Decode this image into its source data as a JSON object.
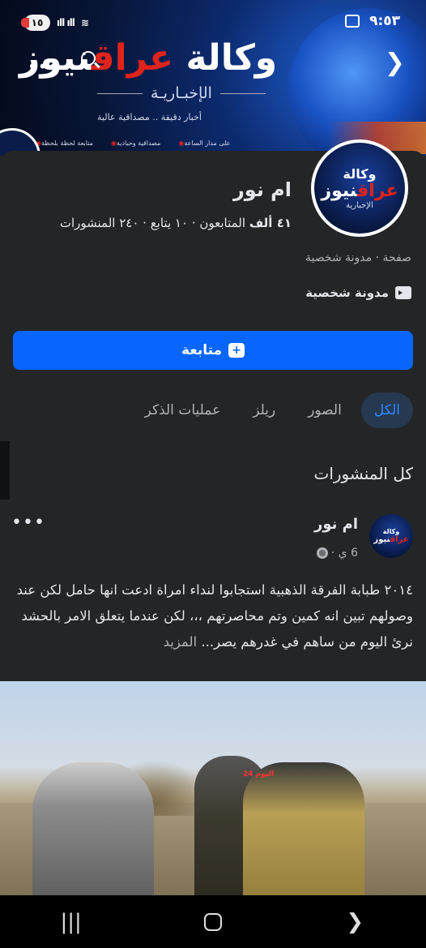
{
  "status_bar": {
    "battery": "١٥",
    "signal": "ıll ıll",
    "time": "٩:٥٣"
  },
  "cover": {
    "title_part1": "وكالة ",
    "title_part2": "عراق",
    "title_part3": "نيوز",
    "subtitle": "الإخبـاريـة",
    "tagline": "أخبار دقيقة .. مصداقية عالية",
    "strip": [
      "متابعة لحظة بلحظة",
      "مصداقية وحيادية",
      "على مدار الساعة"
    ]
  },
  "avatar": {
    "line1": "وكالة",
    "line2_red": "عراق",
    "line2_white": "نيوز",
    "line3": "الإخبارية"
  },
  "page": {
    "name": "ام نور",
    "stats_followers": "٤١ ألف",
    "stats_text": " المتابعون · ١٠ يتابع · ٢٤٠ المنشورات",
    "category": "صفحة · مدونة شخصية",
    "intro": "مدونة شخصية",
    "follow_label": "متابعة"
  },
  "tabs": [
    {
      "label": "الكل",
      "active": true
    },
    {
      "label": "الصور",
      "active": false
    },
    {
      "label": "ريلز",
      "active": false
    },
    {
      "label": "عمليات الذكر",
      "active": false
    }
  ],
  "section_title": "كل المنشورات",
  "post": {
    "author": "ام نور",
    "time": "6 ي ·",
    "text": "٢٠١٤ طبابة الفرقة الذهبية استجابوا لنداء امراة ادعت انها حامل لكن عند وصولهم تبين انه كمين وتم محاصرتهم ،،، لكن عندما يتعلق الامر بالحشد نرئ اليوم من ساهم في غدرهم يصر... ",
    "more": "المزيد",
    "image_watermark": "اليوم 24"
  },
  "colors": {
    "accent": "#0866ff",
    "background": "#242526",
    "brand_red": "#e0241c"
  }
}
